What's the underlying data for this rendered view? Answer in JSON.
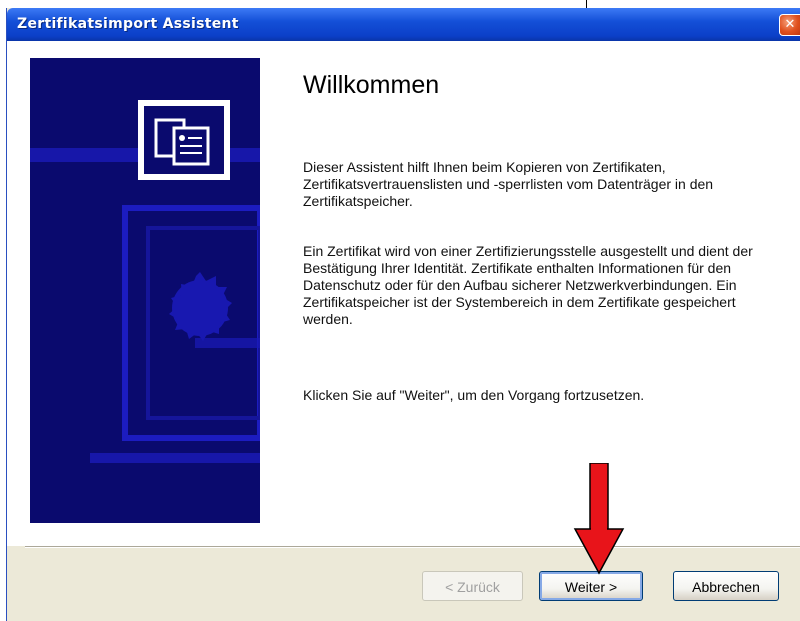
{
  "window": {
    "title": "Zertifikatsimport Assistent",
    "close_glyph": "✕"
  },
  "wizard": {
    "heading": "Willkommen",
    "paragraph_1": "Dieser Assistent hilft Ihnen beim Kopieren von Zertifikaten, Zertifikatsvertrauenslisten und -sperrlisten vom Datenträger in den Zertifikatspeicher.",
    "paragraph_2": "Ein Zertifikat wird von einer Zertifizierungsstelle ausgestellt und dient der Bestätigung Ihrer Identität. Zertifikate enthalten Informationen für den Datenschutz oder für den Aufbau sicherer Netzwerkverbindungen. Ein Zertifikatspeicher ist der Systembereich in dem Zertifikate gespeichert werden.",
    "paragraph_3": "Klicken Sie auf \"Weiter\", um den Vorgang fortzusetzen."
  },
  "buttons": {
    "back": "< Zurück",
    "next": "Weiter >",
    "cancel": "Abbrechen"
  },
  "colors": {
    "titlebar": "#0b3fc8",
    "art_background": "#0a0a6e",
    "annotation_arrow": "#e8141a"
  },
  "icons": {
    "wizard_art": "certificate-icon",
    "annotation": "red-arrow-down"
  }
}
